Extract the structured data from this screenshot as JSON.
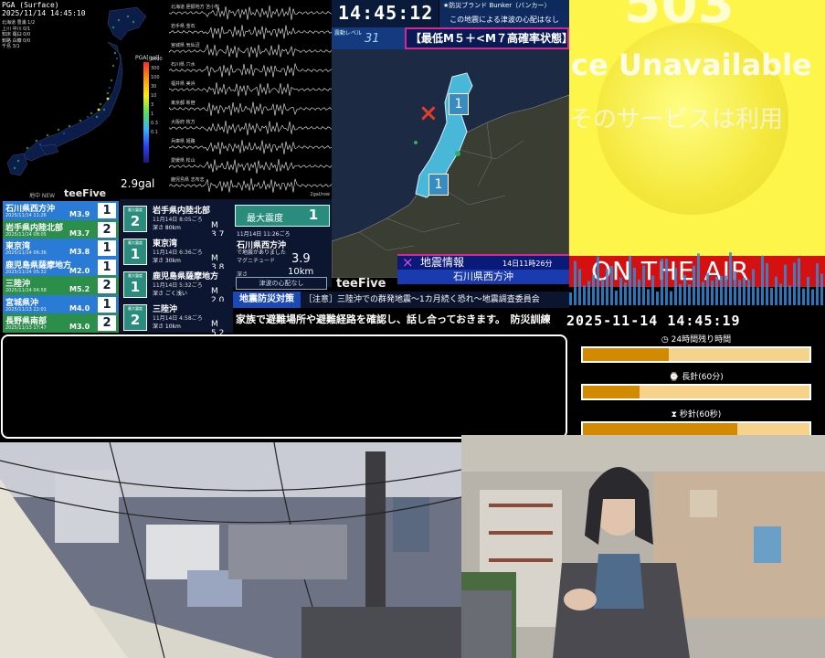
{
  "pga": {
    "header_line1": "PGA (Surface)",
    "header_line2": "2025/11/14 14:45:10",
    "scale_title": "PGA[gal]",
    "scale_values": [
      "1000",
      "300",
      "100",
      "30",
      "10",
      "3",
      "1",
      "0.3",
      "0.1"
    ],
    "current_gal": "2.9gal",
    "caption": "地中 NEW",
    "brand": "teeFive",
    "stations": [
      "北海道 豊浦 1/2",
      "上川 中川 0/1",
      "知床 羅臼 0/0",
      "釧路 白糠 0/0",
      "千島 3/1"
    ]
  },
  "waveforms": {
    "labels": [
      "北海道 胆振地方 苫小牧",
      "岩手県 釜石",
      "宮城県 気仙沼",
      "石川県 穴水",
      "福井県 美浜",
      "東京都 新宿",
      "大阪府 枚方",
      "兵庫県 姫路",
      "愛媛県 松山",
      "鹿児島県 志布志"
    ],
    "scale": "2gal/row"
  },
  "header": {
    "clock": "14:45:12",
    "bunker": "★防災ブランド Bunker（バンカー）",
    "tsunami_note": "この地震による津波の心配はなし",
    "level_label": "震動レベル",
    "level_value": "31",
    "forecast": "【最低M５＋<M７高確率状態】"
  },
  "map": {
    "marker_label_1": "1",
    "marker_label_2": "1",
    "epicenter_icon": "×",
    "info_title": "地震情報",
    "info_time": "14日11時26分",
    "location": "石川県西方沖",
    "brand": "teeFive"
  },
  "events": [
    {
      "place": "石川県西方沖",
      "time": "2025/11/14 11:26",
      "mag": "M3.9",
      "int": "1",
      "color": "#2a7bd6"
    },
    {
      "place": "岩手県内陸北部",
      "time": "2025/11/14 08:05",
      "mag": "M3.7",
      "int": "2",
      "color": "#2b8f4a"
    },
    {
      "place": "東京湾",
      "time": "2025/11/14 06:36",
      "mag": "M3.8",
      "int": "1",
      "color": "#2a7bd6"
    },
    {
      "place": "鹿児島県薩摩地方",
      "time": "2025/11/14 05:32",
      "mag": "M2.0",
      "int": "1",
      "color": "#2a7bd6"
    },
    {
      "place": "三陸沖",
      "time": "2025/11/14 04:58",
      "mag": "M5.2",
      "int": "2",
      "color": "#2b8f4a"
    },
    {
      "place": "宮城県沖",
      "time": "2025/11/13 22:01",
      "mag": "M4.0",
      "int": "1",
      "color": "#2a7bd6"
    },
    {
      "place": "長野県南部",
      "time": "2025/11/13 17:47",
      "mag": "M3.0",
      "int": "2",
      "color": "#2b8f4a"
    }
  ],
  "cards": [
    {
      "shindo_label": "最大震度",
      "shindo": "2",
      "place": "岩手県内陸北部",
      "datetime": "11月14日 8:05ごろ",
      "depth": "深さ 80km",
      "mag": "M 3.7"
    },
    {
      "shindo_label": "最大震度",
      "shindo": "1",
      "place": "東京湾",
      "datetime": "11月14日 6:36ごろ",
      "depth": "深さ 30km",
      "mag": "M 3.8"
    },
    {
      "shindo_label": "最大震度",
      "shindo": "1",
      "place": "鹿児島県薩摩地方",
      "datetime": "11月14日 5:32ごろ",
      "depth": "深さ ごく浅い",
      "mag": "M 2.0"
    },
    {
      "shindo_label": "最大震度",
      "shindo": "2",
      "place": "三陸沖",
      "datetime": "11月14日 4:58ごろ",
      "depth": "深さ 10km",
      "mag": "M 5.2"
    }
  ],
  "maxinfo": {
    "label": "最大震度",
    "value": "1",
    "datetime": "11月14日 11:26ごろ",
    "place": "石川県西方沖",
    "place_sub": "で地震がありました",
    "mag_label": "マグニチュード",
    "mag_value": "3.9",
    "depth_label": "深さ",
    "depth_value": "10km",
    "tsunami": "津波の心配なし"
  },
  "ticker": {
    "bousai": "地震防災対策",
    "news": "［注意］三陸沖での群発地震～1カ月続く恐れ～地震調査委員会",
    "drill": "家族で避難場所や避難経路を確認し、話し合っておきます。　防災訓練"
  },
  "yellow": {
    "code": "503",
    "message": "ce Unavailable",
    "jp": "そのサービスは利用"
  },
  "onair": "ON THE AIR",
  "datetime": "2025-11-14 14:45:19",
  "progress": [
    {
      "label": "24時間残り時間",
      "fraction": 0.38,
      "icon": "clock-icon"
    },
    {
      "label": "長針(60分)",
      "fraction": 0.25,
      "icon": "watch-icon"
    },
    {
      "label": "秒針(60秒)",
      "fraction": 0.68,
      "icon": "hourglass-icon"
    }
  ]
}
